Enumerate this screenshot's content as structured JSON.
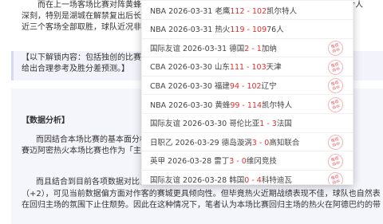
{
  "article": {
    "lines_top": [
      "而在上一场客场比赛对阵黄蜂的比赛，凯尔特人主场108比112输给黄蜂，在比赛中表现令人",
      "深刻，特别是湖城在解禁复出后长了不少关，而现在凯尔特人仅剩的主场只有3场比赛，其中的",
      "近三个客场全部取胜，球队近况非常好。"
    ],
    "quote_lines": [
      "【以下解锁内容：包括独创的比赛分析，数据分析等，结合本场比赛走势进行详细解读，多维",
      "给出合理参考及胜分差预测。】"
    ],
    "section_heading": "【数据分析】",
    "analysis_lines": [
      "而因结合本场比赛的基本面分析，凯尔特人主场优势明显，但黄蜂在客场表现不够充分。",
      "賽迈阿密热火本场比赛也作为「主场」第三节开始",
      "而且结合到目前各项数据对比，凯尔特人在这场比赛的胜率较高，客队的数值",
      "（+2），可见当前数据偏方面对作客的赛城更具倾向性。但毕竟热火近期战绩表现不佳，球队也自然表",
      "在回归主场的氛围下止住颓势。因此在这种情况下，笔者认为本场比赛回归主场的热火在阿德巴约的带"
    ]
  },
  "dropdown": {
    "items": [
      {
        "league": "NBA",
        "date": "2026-03-31",
        "home": "老鹰",
        "score": "112 - 102",
        "away": "凯尔特人",
        "badge": false
      },
      {
        "league": "NBA",
        "date": "2026-03-31",
        "home": "热火",
        "score": "119 - 109",
        "away": "76人",
        "badge": false
      },
      {
        "league": "国际友谊",
        "date": "2026-03-31",
        "home": "德国",
        "score": "2 - 1",
        "away": "加纳",
        "badge": true
      },
      {
        "league": "CBA",
        "date": "2026-03-30",
        "home": "山东",
        "score": "111 - 103",
        "away": "天津",
        "badge": true
      },
      {
        "league": "CBA",
        "date": "2026-03-30",
        "home": "福建",
        "score": "94 - 102",
        "away": "辽宁",
        "badge": true
      },
      {
        "league": "NBA",
        "date": "2026-03-30",
        "home": "黄蜂",
        "score": "99 - 114",
        "away": "凯尔特人",
        "badge": true
      },
      {
        "league": "国际友谊",
        "date": "2026-03-30",
        "home": "哥伦比亚",
        "score": "1 - 3",
        "away": "法国",
        "badge": false
      },
      {
        "league": "日职乙",
        "date": "2026-03-29",
        "home": "德岛漩涡",
        "score": "3 - 0",
        "away": "高知联合",
        "badge": true
      },
      {
        "league": "英甲",
        "date": "2026-03-28",
        "home": "雷丁",
        "score": "3 - 0",
        "away": "维冈竞技",
        "badge": true
      },
      {
        "league": "国际友谊",
        "date": "2026-03-28",
        "home": "韩国",
        "score": "0 - 4",
        "away": "科特迪瓦",
        "badge": true
      }
    ],
    "badge_text": "推荐",
    "badge_sub": "命中"
  },
  "colors": {
    "score": "#e0302b",
    "badge": "#e55b64",
    "quote_bg": "#f3f4fb"
  }
}
